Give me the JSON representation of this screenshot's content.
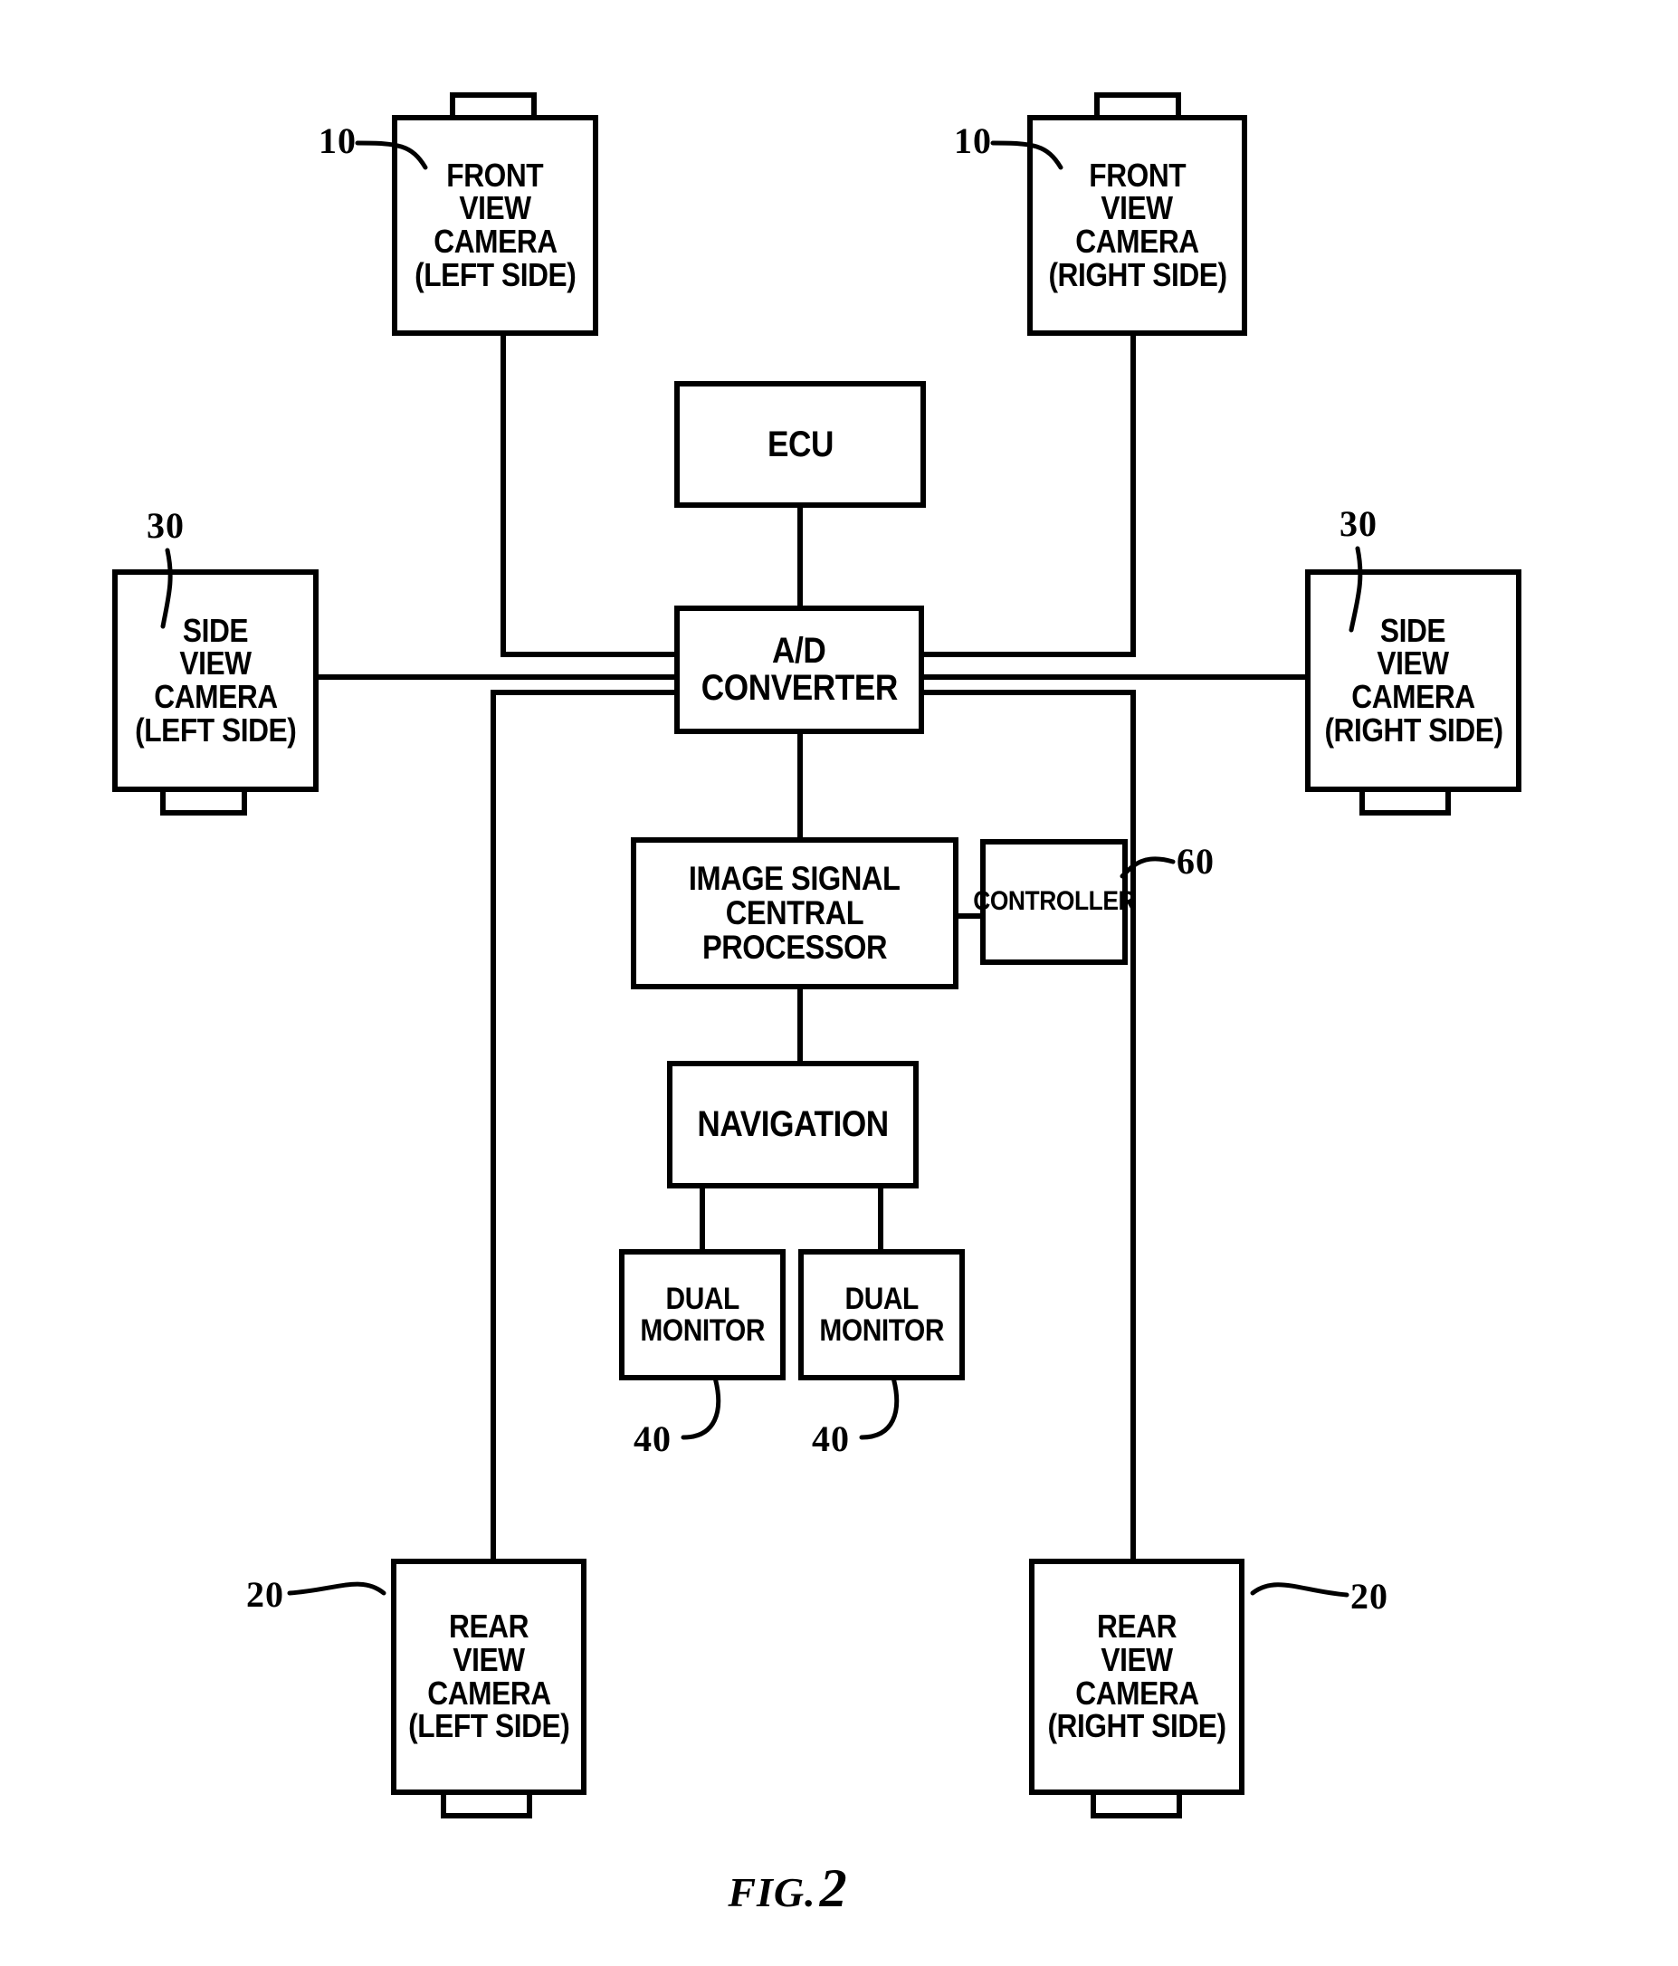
{
  "figure": {
    "caption_word": "FIG.",
    "caption_number": "2",
    "type": "block-diagram",
    "title": "Vehicle multi-camera around view system block diagram"
  },
  "nodes": {
    "front_camera_left": {
      "lines": [
        "FRONT",
        "VIEW",
        "CAMERA",
        "(LEFT SIDE)"
      ],
      "ref": "10"
    },
    "front_camera_right": {
      "lines": [
        "FRONT",
        "VIEW",
        "CAMERA",
        "(RIGHT SIDE)"
      ],
      "ref": "10"
    },
    "side_camera_left": {
      "lines": [
        "SIDE",
        "VIEW",
        "CAMERA",
        "(LEFT SIDE)"
      ],
      "ref": "30"
    },
    "side_camera_right": {
      "lines": [
        "SIDE",
        "VIEW",
        "CAMERA",
        "(RIGHT SIDE)"
      ],
      "ref": "30"
    },
    "rear_camera_left": {
      "lines": [
        "REAR",
        "VIEW",
        "CAMERA",
        "(LEFT SIDE)"
      ],
      "ref": "20"
    },
    "rear_camera_right": {
      "lines": [
        "REAR",
        "VIEW",
        "CAMERA",
        "(RIGHT SIDE)"
      ],
      "ref": "20"
    },
    "ecu": {
      "lines": [
        "ECU"
      ],
      "ref": ""
    },
    "ad_converter": {
      "lines": [
        "A/D",
        "CONVERTER"
      ],
      "ref": ""
    },
    "image_processor": {
      "lines": [
        "IMAGE SIGNAL",
        "CENTRAL PROCESSOR"
      ],
      "ref": ""
    },
    "controller": {
      "lines": [
        "CONTROLLER"
      ],
      "ref": "60"
    },
    "navigation": {
      "lines": [
        "NAVIGATION"
      ],
      "ref": ""
    },
    "dual_monitor_left": {
      "lines": [
        "DUAL",
        "MONITOR"
      ],
      "ref": "40"
    },
    "dual_monitor_right": {
      "lines": [
        "DUAL",
        "MONITOR"
      ],
      "ref": "40"
    }
  },
  "colors": {
    "stroke": "#000000",
    "background": "#ffffff",
    "text": "#000000"
  }
}
